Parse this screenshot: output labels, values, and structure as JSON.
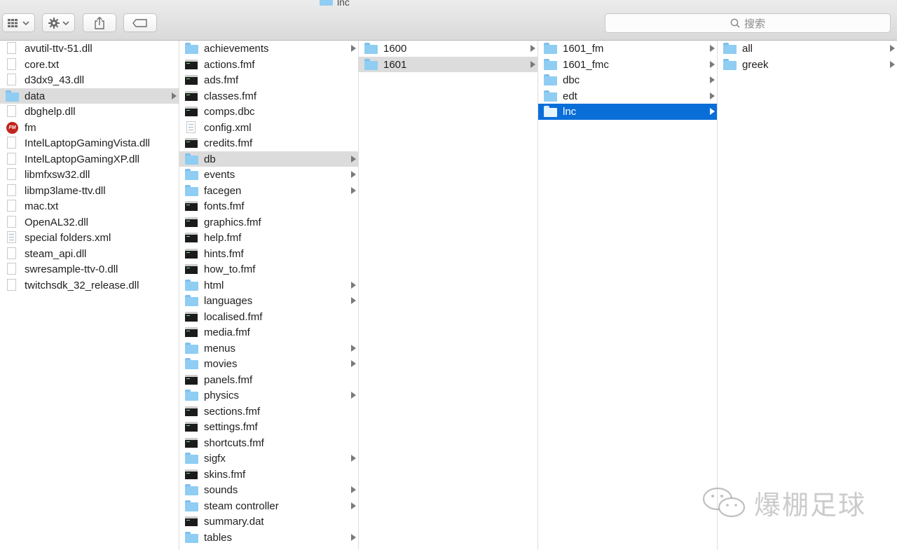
{
  "window": {
    "title": "lnc"
  },
  "toolbar": {
    "view_icon": "grid-view-icon",
    "action_icon": "gear-icon",
    "share_icon": "share-icon",
    "tag_icon": "tag-icon"
  },
  "search": {
    "placeholder": "搜索",
    "icon": "search-icon"
  },
  "columns": [
    {
      "items": [
        {
          "label": "avutil-ttv-51.dll",
          "icon": "document-icon"
        },
        {
          "label": "core.txt",
          "icon": "document-icon"
        },
        {
          "label": "d3dx9_43.dll",
          "icon": "document-icon"
        },
        {
          "label": "data",
          "icon": "folder-icon",
          "state": "grey",
          "has_children": true
        },
        {
          "label": "dbghelp.dll",
          "icon": "document-icon"
        },
        {
          "label": "fm",
          "icon": "fm-app-icon"
        },
        {
          "label": "IntelLaptopGamingVista.dll",
          "icon": "document-icon"
        },
        {
          "label": "IntelLaptopGamingXP.dll",
          "icon": "document-icon"
        },
        {
          "label": "libmfxsw32.dll",
          "icon": "document-icon"
        },
        {
          "label": "libmp3lame-ttv.dll",
          "icon": "document-icon"
        },
        {
          "label": "mac.txt",
          "icon": "document-icon"
        },
        {
          "label": "OpenAL32.dll",
          "icon": "document-icon"
        },
        {
          "label": "special folders.xml",
          "icon": "xml-document-icon"
        },
        {
          "label": "steam_api.dll",
          "icon": "document-icon"
        },
        {
          "label": "swresample-ttv-0.dll",
          "icon": "document-icon"
        },
        {
          "label": "twitchsdk_32_release.dll",
          "icon": "document-icon"
        }
      ]
    },
    {
      "items": [
        {
          "label": "achievements",
          "icon": "folder-icon",
          "has_children": true
        },
        {
          "label": "actions.fmf",
          "icon": "exec-file-icon"
        },
        {
          "label": "ads.fmf",
          "icon": "exec-file-icon"
        },
        {
          "label": "classes.fmf",
          "icon": "exec-file-icon"
        },
        {
          "label": "comps.dbc",
          "icon": "exec-file-icon"
        },
        {
          "label": "config.xml",
          "icon": "xml-document-icon"
        },
        {
          "label": "credits.fmf",
          "icon": "exec-file-icon"
        },
        {
          "label": "db",
          "icon": "folder-icon",
          "state": "grey",
          "has_children": true
        },
        {
          "label": "events",
          "icon": "folder-icon",
          "has_children": true
        },
        {
          "label": "facegen",
          "icon": "folder-icon",
          "has_children": true
        },
        {
          "label": "fonts.fmf",
          "icon": "exec-file-icon"
        },
        {
          "label": "graphics.fmf",
          "icon": "exec-file-icon"
        },
        {
          "label": "help.fmf",
          "icon": "exec-file-icon"
        },
        {
          "label": "hints.fmf",
          "icon": "exec-file-icon"
        },
        {
          "label": "how_to.fmf",
          "icon": "exec-file-icon"
        },
        {
          "label": "html",
          "icon": "folder-icon",
          "has_children": true
        },
        {
          "label": "languages",
          "icon": "folder-icon",
          "has_children": true
        },
        {
          "label": "localised.fmf",
          "icon": "exec-file-icon"
        },
        {
          "label": "media.fmf",
          "icon": "exec-file-icon"
        },
        {
          "label": "menus",
          "icon": "folder-icon",
          "has_children": true
        },
        {
          "label": "movies",
          "icon": "folder-icon",
          "has_children": true
        },
        {
          "label": "panels.fmf",
          "icon": "exec-file-icon"
        },
        {
          "label": "physics",
          "icon": "folder-icon",
          "has_children": true
        },
        {
          "label": "sections.fmf",
          "icon": "exec-file-icon"
        },
        {
          "label": "settings.fmf",
          "icon": "exec-file-icon"
        },
        {
          "label": "shortcuts.fmf",
          "icon": "exec-file-icon"
        },
        {
          "label": "sigfx",
          "icon": "folder-icon",
          "has_children": true
        },
        {
          "label": "skins.fmf",
          "icon": "exec-file-icon"
        },
        {
          "label": "sounds",
          "icon": "folder-icon",
          "has_children": true
        },
        {
          "label": "steam controller",
          "icon": "folder-icon",
          "has_children": true
        },
        {
          "label": "summary.dat",
          "icon": "exec-file-icon"
        },
        {
          "label": "tables",
          "icon": "folder-icon",
          "has_children": true
        }
      ]
    },
    {
      "items": [
        {
          "label": "1600",
          "icon": "folder-icon",
          "has_children": true
        },
        {
          "label": "1601",
          "icon": "folder-icon",
          "state": "grey",
          "has_children": true
        }
      ]
    },
    {
      "items": [
        {
          "label": "1601_fm",
          "icon": "folder-icon",
          "has_children": true
        },
        {
          "label": "1601_fmc",
          "icon": "folder-icon",
          "has_children": true
        },
        {
          "label": "dbc",
          "icon": "folder-icon",
          "has_children": true
        },
        {
          "label": "edt",
          "icon": "folder-icon",
          "has_children": true
        },
        {
          "label": "lnc",
          "icon": "folder-icon",
          "state": "blue",
          "has_children": true
        }
      ]
    },
    {
      "items": [
        {
          "label": "all",
          "icon": "folder-icon",
          "has_children": true
        },
        {
          "label": "greek",
          "icon": "folder-icon",
          "has_children": true
        }
      ]
    }
  ],
  "watermark": {
    "text": "爆棚足球",
    "icon": "wechat-icon"
  },
  "colors": {
    "selection_blue": "#0a6ed9",
    "path_grey": "#dcdcdc",
    "folder_blue": "#8fcdf3"
  }
}
